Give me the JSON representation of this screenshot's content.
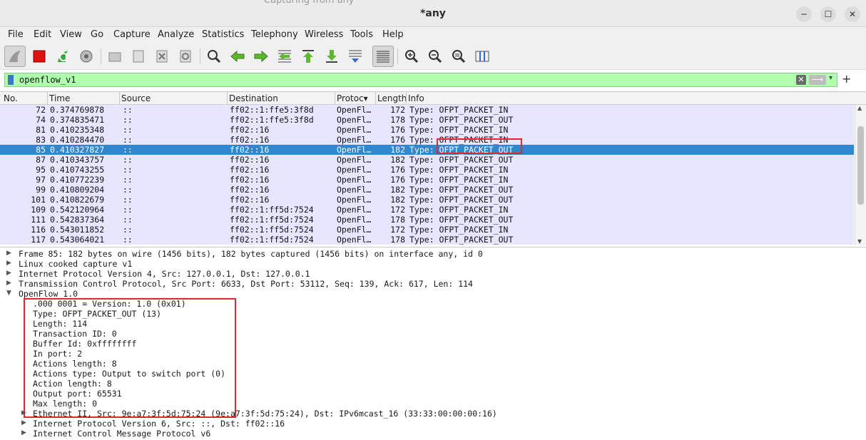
{
  "window": {
    "ghost_title": "Capturing from any",
    "title": "*any",
    "minimize": "─",
    "maximize": "☐",
    "close": "✕"
  },
  "menu": [
    {
      "label": "File"
    },
    {
      "label": "Edit"
    },
    {
      "label": "View"
    },
    {
      "label": "Go"
    },
    {
      "label": "Capture"
    },
    {
      "label": "Analyze"
    },
    {
      "label": "Statistics"
    },
    {
      "label": "Telephony"
    },
    {
      "label": "Wireless"
    },
    {
      "label": "Tools"
    },
    {
      "label": "Help"
    }
  ],
  "toolbar": {
    "icons": [
      "shark-fin-icon",
      "stop-capture-icon",
      "restart-capture-icon",
      "capture-options-icon",
      "open-file-icon",
      "save-file-icon",
      "close-file-icon",
      "reload-file-icon",
      "find-packet-icon",
      "go-back-icon",
      "go-forward-icon",
      "go-to-packet-icon",
      "first-packet-icon",
      "last-packet-icon",
      "autoscroll-icon",
      "colorize-icon",
      "zoom-in-icon",
      "zoom-out-icon",
      "zoom-reset-icon",
      "resize-columns-icon"
    ]
  },
  "filter": {
    "value": "openflow_v1",
    "clear": "✕",
    "apply": "⟶",
    "dropdown": "▾",
    "add": "+"
  },
  "packet_list": {
    "columns": {
      "no": "No.",
      "time": "Time",
      "source": "Source",
      "destination": "Destination",
      "protocol": "Protoc▾",
      "length": "Length",
      "info": "Info"
    },
    "rows": [
      {
        "no": "72",
        "time": "0.374769878",
        "src": "::",
        "dst": "ff02::1:ffe5:3f8d",
        "proto": "OpenFl…",
        "len": "172",
        "info": "Type: OFPT_PACKET_IN"
      },
      {
        "no": "74",
        "time": "0.374835471",
        "src": "::",
        "dst": "ff02::1:ffe5:3f8d",
        "proto": "OpenFl…",
        "len": "178",
        "info": "Type: OFPT_PACKET_OUT"
      },
      {
        "no": "81",
        "time": "0.410235348",
        "src": "::",
        "dst": "ff02::16",
        "proto": "OpenFl…",
        "len": "176",
        "info": "Type: OFPT_PACKET_IN"
      },
      {
        "no": "83",
        "time": "0.410284470",
        "src": "::",
        "dst": "ff02::16",
        "proto": "OpenFl…",
        "len": "176",
        "info": "Type: OFPT_PACKET_IN"
      },
      {
        "no": "85",
        "time": "0.410327827",
        "src": "::",
        "dst": "ff02::16",
        "proto": "OpenFl…",
        "len": "182",
        "info": "Type: OFPT_PACKET_OUT"
      },
      {
        "no": "87",
        "time": "0.410343757",
        "src": "::",
        "dst": "ff02::16",
        "proto": "OpenFl…",
        "len": "182",
        "info": "Type: OFPT_PACKET_OUT"
      },
      {
        "no": "95",
        "time": "0.410743255",
        "src": "::",
        "dst": "ff02::16",
        "proto": "OpenFl…",
        "len": "176",
        "info": "Type: OFPT_PACKET_IN"
      },
      {
        "no": "97",
        "time": "0.410772239",
        "src": "::",
        "dst": "ff02::16",
        "proto": "OpenFl…",
        "len": "176",
        "info": "Type: OFPT_PACKET_IN"
      },
      {
        "no": "99",
        "time": "0.410809204",
        "src": "::",
        "dst": "ff02::16",
        "proto": "OpenFl…",
        "len": "182",
        "info": "Type: OFPT_PACKET_OUT"
      },
      {
        "no": "101",
        "time": "0.410822679",
        "src": "::",
        "dst": "ff02::16",
        "proto": "OpenFl…",
        "len": "182",
        "info": "Type: OFPT_PACKET_OUT"
      },
      {
        "no": "109",
        "time": "0.542120964",
        "src": "::",
        "dst": "ff02::1:ff5d:7524",
        "proto": "OpenFl…",
        "len": "172",
        "info": "Type: OFPT_PACKET_IN"
      },
      {
        "no": "111",
        "time": "0.542837364",
        "src": "::",
        "dst": "ff02::1:ff5d:7524",
        "proto": "OpenFl…",
        "len": "178",
        "info": "Type: OFPT_PACKET_OUT"
      },
      {
        "no": "116",
        "time": "0.543011852",
        "src": "::",
        "dst": "ff02::1:ff5d:7524",
        "proto": "OpenFl…",
        "len": "172",
        "info": "Type: OFPT_PACKET_IN"
      },
      {
        "no": "117",
        "time": "0.543064021",
        "src": "::",
        "dst": "ff02::1:ff5d:7524",
        "proto": "OpenFl…",
        "len": "178",
        "info": "Type: OFPT_PACKET_OUT"
      }
    ],
    "selected_no": "85",
    "colors": {
      "row": "#e7e6ff",
      "selected": "#2e87cf",
      "highlight": "#e0282e"
    }
  },
  "details": {
    "tree": [
      {
        "text": "Frame 85: 182 bytes on wire (1456 bits), 182 bytes captured (1456 bits) on interface any, id 0",
        "level": 0,
        "expanded": false
      },
      {
        "text": "Linux cooked capture v1",
        "level": 0,
        "expanded": false
      },
      {
        "text": "Internet Protocol Version 4, Src: 127.0.0.1, Dst: 127.0.0.1",
        "level": 0,
        "expanded": false
      },
      {
        "text": "Transmission Control Protocol, Src Port: 6633, Dst Port: 53112, Seq: 139, Ack: 617, Len: 114",
        "level": 0,
        "expanded": false
      },
      {
        "text": "OpenFlow 1.0",
        "level": 0,
        "expanded": true
      }
    ],
    "openflow_fields": [
      ".000 0001 = Version: 1.0 (0x01)",
      "Type: OFPT_PACKET_OUT (13)",
      "Length: 114",
      "Transaction ID: 0",
      "Buffer Id: 0xffffffff",
      "In port: 2",
      "Actions length: 8",
      "Actions type: Output to switch port (0)",
      "Action length: 8",
      "Output port: 65531",
      "Max length: 0"
    ],
    "inner": [
      "Ethernet II, Src: 9e:a7:3f:5d:75:24 (9e:a7:3f:5d:75:24), Dst: IPv6mcast_16 (33:33:00:00:00:16)",
      "Internet Protocol Version 6, Src: ::, Dst: ff02::16",
      "Internet Control Message Protocol v6"
    ]
  }
}
